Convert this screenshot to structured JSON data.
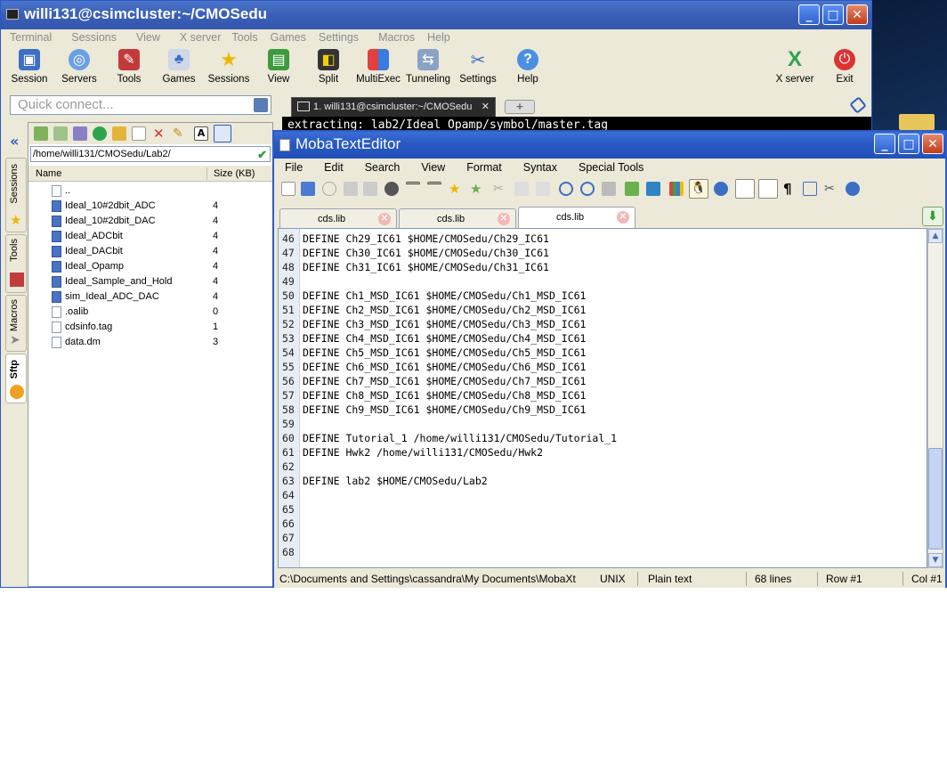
{
  "main_window": {
    "title": "willi131@csimcluster:~/CMOSedu",
    "menu": [
      "Terminal",
      "Sessions",
      "View",
      "X server",
      "Tools",
      "Games",
      "Settings",
      "Macros",
      "Help"
    ],
    "toolbar": [
      "Session",
      "Servers",
      "Tools",
      "Games",
      "Sessions",
      "View",
      "Split",
      "MultiExec",
      "Tunneling",
      "Settings",
      "Help",
      "X server",
      "Exit"
    ],
    "quick_connect_placeholder": "Quick connect...",
    "vertical_tabs": [
      "Sessions",
      "Tools",
      "Macros",
      "Sftp"
    ]
  },
  "sftp": {
    "path": "/home/willi131/CMOSedu/Lab2/",
    "columns": [
      "Name",
      "Size (KB)"
    ],
    "files": [
      {
        "name": "..",
        "size": "",
        "type": "dir"
      },
      {
        "name": "Ideal_10#2dbit_ADC",
        "size": "4",
        "type": "dir"
      },
      {
        "name": "Ideal_10#2dbit_DAC",
        "size": "4",
        "type": "dir"
      },
      {
        "name": "Ideal_ADCbit",
        "size": "4",
        "type": "dir"
      },
      {
        "name": "Ideal_DACbit",
        "size": "4",
        "type": "dir"
      },
      {
        "name": "Ideal_Opamp",
        "size": "4",
        "type": "dir"
      },
      {
        "name": "Ideal_Sample_and_Hold",
        "size": "4",
        "type": "dir"
      },
      {
        "name": "sim_Ideal_ADC_DAC",
        "size": "4",
        "type": "dir"
      },
      {
        "name": ".oalib",
        "size": "0",
        "type": "file"
      },
      {
        "name": "cdsinfo.tag",
        "size": "1",
        "type": "file"
      },
      {
        "name": "data.dm",
        "size": "3",
        "type": "file"
      }
    ]
  },
  "terminal": {
    "tab_label": "1. willi131@csimcluster:~/CMOSedu",
    "visible_line": "extracting: lab2/Ideal_Opamp/symbol/master.tag"
  },
  "editor": {
    "title": "MobaTextEditor",
    "menu": [
      "File",
      "Edit",
      "Search",
      "View",
      "Format",
      "Syntax",
      "Special Tools"
    ],
    "tabs": [
      "cds.lib",
      "cds.lib",
      "cds.lib"
    ],
    "lines": [
      {
        "n": "46",
        "t": "DEFINE Ch29_IC61 $HOME/CMOSedu/Ch29_IC61"
      },
      {
        "n": "47",
        "t": "DEFINE Ch30_IC61 $HOME/CMOSedu/Ch30_IC61"
      },
      {
        "n": "48",
        "t": "DEFINE Ch31_IC61 $HOME/CMOSedu/Ch31_IC61"
      },
      {
        "n": "49",
        "t": ""
      },
      {
        "n": "50",
        "t": "DEFINE Ch1_MSD_IC61 $HOME/CMOSedu/Ch1_MSD_IC61"
      },
      {
        "n": "51",
        "t": "DEFINE Ch2_MSD_IC61 $HOME/CMOSedu/Ch2_MSD_IC61"
      },
      {
        "n": "52",
        "t": "DEFINE Ch3_MSD_IC61 $HOME/CMOSedu/Ch3_MSD_IC61"
      },
      {
        "n": "53",
        "t": "DEFINE Ch4_MSD_IC61 $HOME/CMOSedu/Ch4_MSD_IC61"
      },
      {
        "n": "54",
        "t": "DEFINE Ch5_MSD_IC61 $HOME/CMOSedu/Ch5_MSD_IC61"
      },
      {
        "n": "55",
        "t": "DEFINE Ch6_MSD_IC61 $HOME/CMOSedu/Ch6_MSD_IC61"
      },
      {
        "n": "56",
        "t": "DEFINE Ch7_MSD_IC61 $HOME/CMOSedu/Ch7_MSD_IC61"
      },
      {
        "n": "57",
        "t": "DEFINE Ch8_MSD_IC61 $HOME/CMOSedu/Ch8_MSD_IC61"
      },
      {
        "n": "58",
        "t": "DEFINE Ch9_MSD_IC61 $HOME/CMOSedu/Ch9_MSD_IC61"
      },
      {
        "n": "59",
        "t": ""
      },
      {
        "n": "60",
        "t": "DEFINE Tutorial_1 /home/willi131/CMOSedu/Tutorial_1"
      },
      {
        "n": "61",
        "t": "DEFINE Hwk2 /home/willi131/CMOSedu/Hwk2"
      },
      {
        "n": "62",
        "t": ""
      },
      {
        "n": "63",
        "t": "DEFINE lab2 $HOME/CMOSedu/Lab2"
      },
      {
        "n": "64",
        "t": ""
      },
      {
        "n": "65",
        "t": ""
      },
      {
        "n": "66",
        "t": ""
      },
      {
        "n": "67",
        "t": ""
      },
      {
        "n": "68",
        "t": ""
      }
    ],
    "status": {
      "path": "C:\\Documents and Settings\\cassandra\\My Documents\\MobaXt",
      "eol": "UNIX",
      "syntax": "Plain text",
      "lines": "68 lines",
      "row": "Row #1",
      "col": "Col #1"
    }
  }
}
